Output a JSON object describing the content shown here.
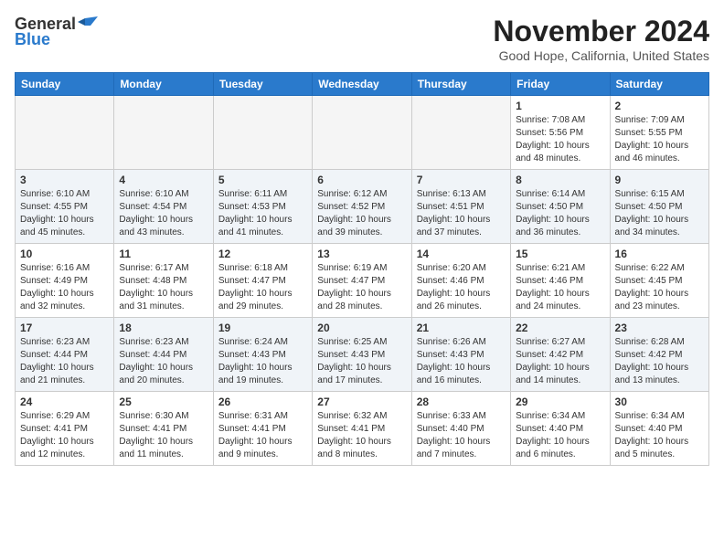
{
  "header": {
    "logo_general": "General",
    "logo_blue": "Blue",
    "month_title": "November 2024",
    "location": "Good Hope, California, United States"
  },
  "weekdays": [
    "Sunday",
    "Monday",
    "Tuesday",
    "Wednesday",
    "Thursday",
    "Friday",
    "Saturday"
  ],
  "weeks": [
    [
      {
        "day": "",
        "empty": true
      },
      {
        "day": "",
        "empty": true
      },
      {
        "day": "",
        "empty": true
      },
      {
        "day": "",
        "empty": true
      },
      {
        "day": "",
        "empty": true
      },
      {
        "day": "1",
        "sunrise": "Sunrise: 7:08 AM",
        "sunset": "Sunset: 5:56 PM",
        "daylight": "Daylight: 10 hours and 48 minutes."
      },
      {
        "day": "2",
        "sunrise": "Sunrise: 7:09 AM",
        "sunset": "Sunset: 5:55 PM",
        "daylight": "Daylight: 10 hours and 46 minutes."
      }
    ],
    [
      {
        "day": "3",
        "sunrise": "Sunrise: 6:10 AM",
        "sunset": "Sunset: 4:55 PM",
        "daylight": "Daylight: 10 hours and 45 minutes."
      },
      {
        "day": "4",
        "sunrise": "Sunrise: 6:10 AM",
        "sunset": "Sunset: 4:54 PM",
        "daylight": "Daylight: 10 hours and 43 minutes."
      },
      {
        "day": "5",
        "sunrise": "Sunrise: 6:11 AM",
        "sunset": "Sunset: 4:53 PM",
        "daylight": "Daylight: 10 hours and 41 minutes."
      },
      {
        "day": "6",
        "sunrise": "Sunrise: 6:12 AM",
        "sunset": "Sunset: 4:52 PM",
        "daylight": "Daylight: 10 hours and 39 minutes."
      },
      {
        "day": "7",
        "sunrise": "Sunrise: 6:13 AM",
        "sunset": "Sunset: 4:51 PM",
        "daylight": "Daylight: 10 hours and 37 minutes."
      },
      {
        "day": "8",
        "sunrise": "Sunrise: 6:14 AM",
        "sunset": "Sunset: 4:50 PM",
        "daylight": "Daylight: 10 hours and 36 minutes."
      },
      {
        "day": "9",
        "sunrise": "Sunrise: 6:15 AM",
        "sunset": "Sunset: 4:50 PM",
        "daylight": "Daylight: 10 hours and 34 minutes."
      }
    ],
    [
      {
        "day": "10",
        "sunrise": "Sunrise: 6:16 AM",
        "sunset": "Sunset: 4:49 PM",
        "daylight": "Daylight: 10 hours and 32 minutes."
      },
      {
        "day": "11",
        "sunrise": "Sunrise: 6:17 AM",
        "sunset": "Sunset: 4:48 PM",
        "daylight": "Daylight: 10 hours and 31 minutes."
      },
      {
        "day": "12",
        "sunrise": "Sunrise: 6:18 AM",
        "sunset": "Sunset: 4:47 PM",
        "daylight": "Daylight: 10 hours and 29 minutes."
      },
      {
        "day": "13",
        "sunrise": "Sunrise: 6:19 AM",
        "sunset": "Sunset: 4:47 PM",
        "daylight": "Daylight: 10 hours and 28 minutes."
      },
      {
        "day": "14",
        "sunrise": "Sunrise: 6:20 AM",
        "sunset": "Sunset: 4:46 PM",
        "daylight": "Daylight: 10 hours and 26 minutes."
      },
      {
        "day": "15",
        "sunrise": "Sunrise: 6:21 AM",
        "sunset": "Sunset: 4:46 PM",
        "daylight": "Daylight: 10 hours and 24 minutes."
      },
      {
        "day": "16",
        "sunrise": "Sunrise: 6:22 AM",
        "sunset": "Sunset: 4:45 PM",
        "daylight": "Daylight: 10 hours and 23 minutes."
      }
    ],
    [
      {
        "day": "17",
        "sunrise": "Sunrise: 6:23 AM",
        "sunset": "Sunset: 4:44 PM",
        "daylight": "Daylight: 10 hours and 21 minutes."
      },
      {
        "day": "18",
        "sunrise": "Sunrise: 6:23 AM",
        "sunset": "Sunset: 4:44 PM",
        "daylight": "Daylight: 10 hours and 20 minutes."
      },
      {
        "day": "19",
        "sunrise": "Sunrise: 6:24 AM",
        "sunset": "Sunset: 4:43 PM",
        "daylight": "Daylight: 10 hours and 19 minutes."
      },
      {
        "day": "20",
        "sunrise": "Sunrise: 6:25 AM",
        "sunset": "Sunset: 4:43 PM",
        "daylight": "Daylight: 10 hours and 17 minutes."
      },
      {
        "day": "21",
        "sunrise": "Sunrise: 6:26 AM",
        "sunset": "Sunset: 4:43 PM",
        "daylight": "Daylight: 10 hours and 16 minutes."
      },
      {
        "day": "22",
        "sunrise": "Sunrise: 6:27 AM",
        "sunset": "Sunset: 4:42 PM",
        "daylight": "Daylight: 10 hours and 14 minutes."
      },
      {
        "day": "23",
        "sunrise": "Sunrise: 6:28 AM",
        "sunset": "Sunset: 4:42 PM",
        "daylight": "Daylight: 10 hours and 13 minutes."
      }
    ],
    [
      {
        "day": "24",
        "sunrise": "Sunrise: 6:29 AM",
        "sunset": "Sunset: 4:41 PM",
        "daylight": "Daylight: 10 hours and 12 minutes."
      },
      {
        "day": "25",
        "sunrise": "Sunrise: 6:30 AM",
        "sunset": "Sunset: 4:41 PM",
        "daylight": "Daylight: 10 hours and 11 minutes."
      },
      {
        "day": "26",
        "sunrise": "Sunrise: 6:31 AM",
        "sunset": "Sunset: 4:41 PM",
        "daylight": "Daylight: 10 hours and 9 minutes."
      },
      {
        "day": "27",
        "sunrise": "Sunrise: 6:32 AM",
        "sunset": "Sunset: 4:41 PM",
        "daylight": "Daylight: 10 hours and 8 minutes."
      },
      {
        "day": "28",
        "sunrise": "Sunrise: 6:33 AM",
        "sunset": "Sunset: 4:40 PM",
        "daylight": "Daylight: 10 hours and 7 minutes."
      },
      {
        "day": "29",
        "sunrise": "Sunrise: 6:34 AM",
        "sunset": "Sunset: 4:40 PM",
        "daylight": "Daylight: 10 hours and 6 minutes."
      },
      {
        "day": "30",
        "sunrise": "Sunrise: 6:34 AM",
        "sunset": "Sunset: 4:40 PM",
        "daylight": "Daylight: 10 hours and 5 minutes."
      }
    ]
  ]
}
